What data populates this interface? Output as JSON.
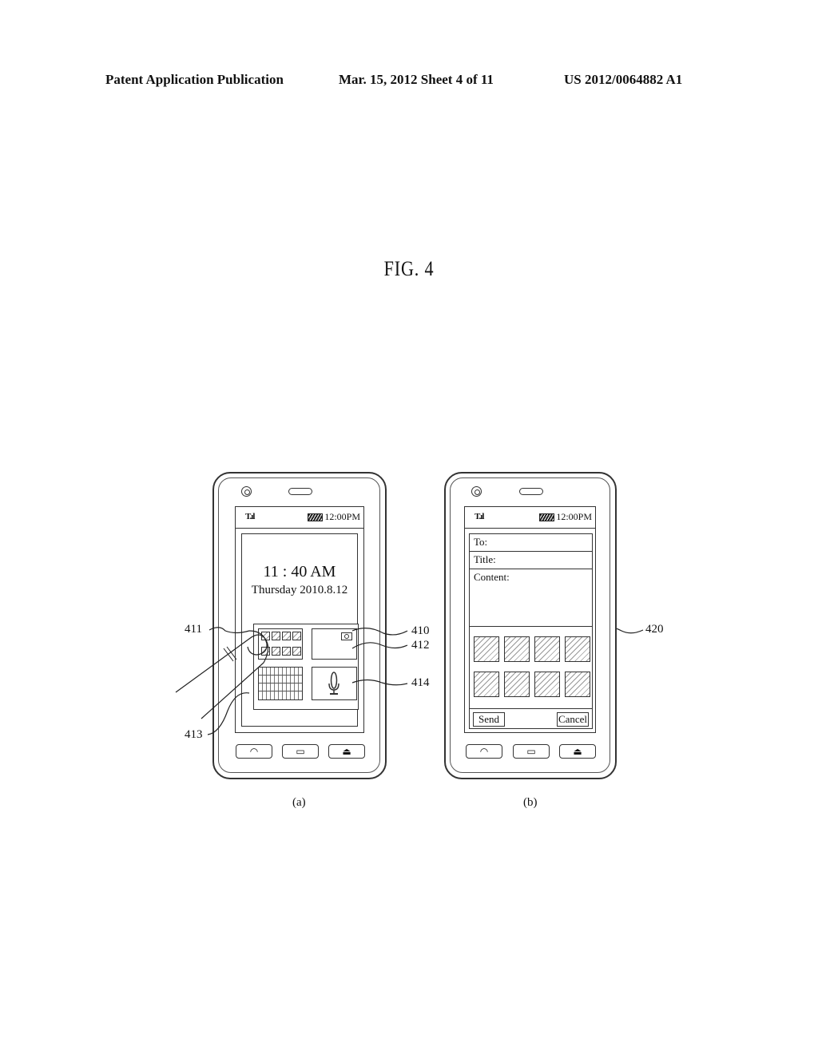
{
  "header": {
    "publication": "Patent Application Publication",
    "date_sheet": "Mar. 15, 2012  Sheet 4 of 11",
    "patent_number": "US 2012/0064882 A1"
  },
  "figure": {
    "title": "FIG. 4"
  },
  "phone_a": {
    "status_time": "12:00PM",
    "clock": "11 : 40 AM",
    "date": "Thursday 2010.8.12",
    "caption": "(a)",
    "refs": {
      "r410": "410",
      "r411": "411",
      "r412": "412",
      "r413": "413",
      "r414": "414"
    },
    "icons": [
      "grid-widget",
      "camera-icon",
      "keyboard-widget",
      "microphone-icon"
    ]
  },
  "phone_b": {
    "status_time": "12:00PM",
    "to_label": "To:",
    "title_label": "Title:",
    "content_label": "Content:",
    "send_label": "Send",
    "cancel_label": "Cancel",
    "caption": "(b)",
    "refs": {
      "r420": "420"
    }
  },
  "hardware_buttons": [
    "call-icon",
    "menu-icon",
    "end-call-icon"
  ]
}
